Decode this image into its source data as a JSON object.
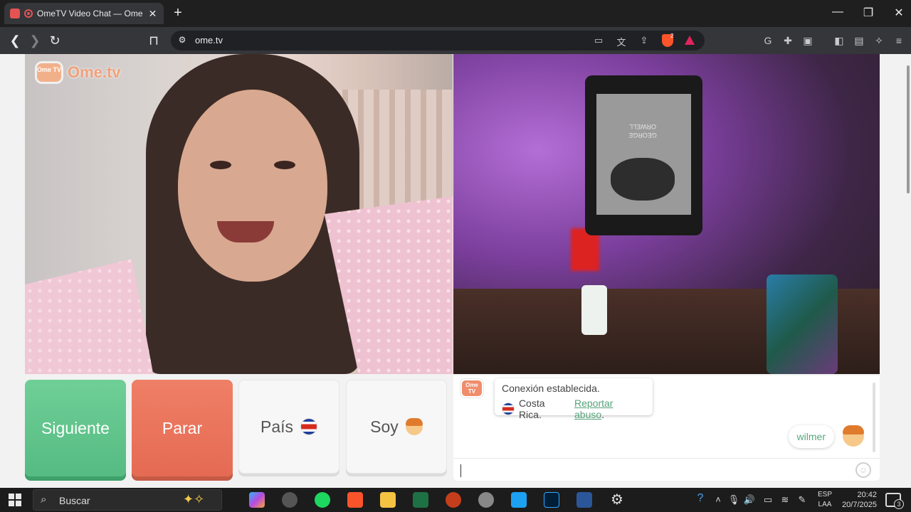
{
  "browser": {
    "tab_title": "OmeTV Video Chat — Omegl",
    "tab_close": "✕",
    "new_tab": "+",
    "window": {
      "minimize": "—",
      "maximize": "❐",
      "close": "✕"
    },
    "url": "ome.tv",
    "shield_count": "2"
  },
  "site": {
    "logo_badge": "Ome TV",
    "logo_text": "Ome.tv"
  },
  "stranger_video": {
    "book_title": "GEORGE ORWELL"
  },
  "controls": {
    "next_label": "Siguiente",
    "stop_label": "Parar",
    "country_label": "País",
    "me_label": "Soy"
  },
  "chat": {
    "logo_badge": "Ome TV",
    "system_line1": "Conexión establecida.",
    "system_country": "Costa Rica.",
    "report_link": "Reportar abuso",
    "report_suffix": ".",
    "my_message": "wilmer",
    "input_value": ""
  },
  "taskbar": {
    "search_placeholder": "Buscar",
    "lang_line1": "ESP",
    "lang_line2": "LAA",
    "time": "20:42",
    "date": "20/7/2025",
    "notification_count": "3"
  },
  "colors": {
    "next_button": "#5ec48a",
    "stop_button": "#e9735b",
    "link": "#55a37a",
    "brand": "#f0a27d"
  }
}
